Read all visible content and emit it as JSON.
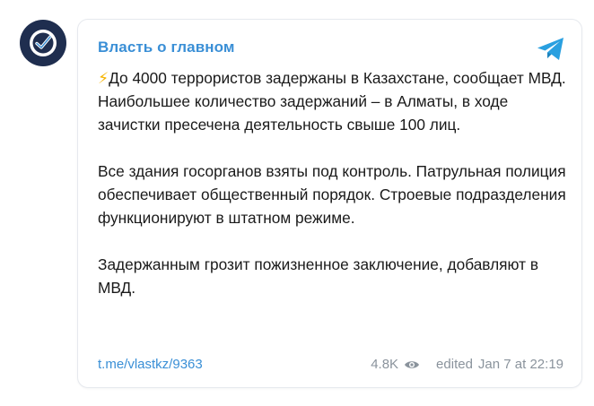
{
  "channel": {
    "name": "Власть о главном",
    "icon": "checkmark-logo"
  },
  "post": {
    "emoji": "⚡",
    "paragraphs": [
      "До 4000 террористов задержаны в Казахстане, сообщает МВД. Наибольшее количество задержаний – в Алматы, в ходе зачистки пресечена деятельность свыше 100 лиц.",
      "Все здания госорганов взяты под контроль. Патрульная полиция обеспечивает общественный порядок. Строевые подразделения функционируют в штатном режиме.",
      "Задержанным грозит пожизненное заключение, добавляют в МВД."
    ]
  },
  "footer": {
    "link": "t.me/vlastkz/9363",
    "views": "4.8K",
    "edited_label": "edited",
    "timestamp": "Jan 7 at 22:19"
  },
  "colors": {
    "accent": "#3a8fd6",
    "avatar_bg": "#1f2e4f",
    "telegram": "#2aa0e0",
    "muted": "#8a939c"
  }
}
